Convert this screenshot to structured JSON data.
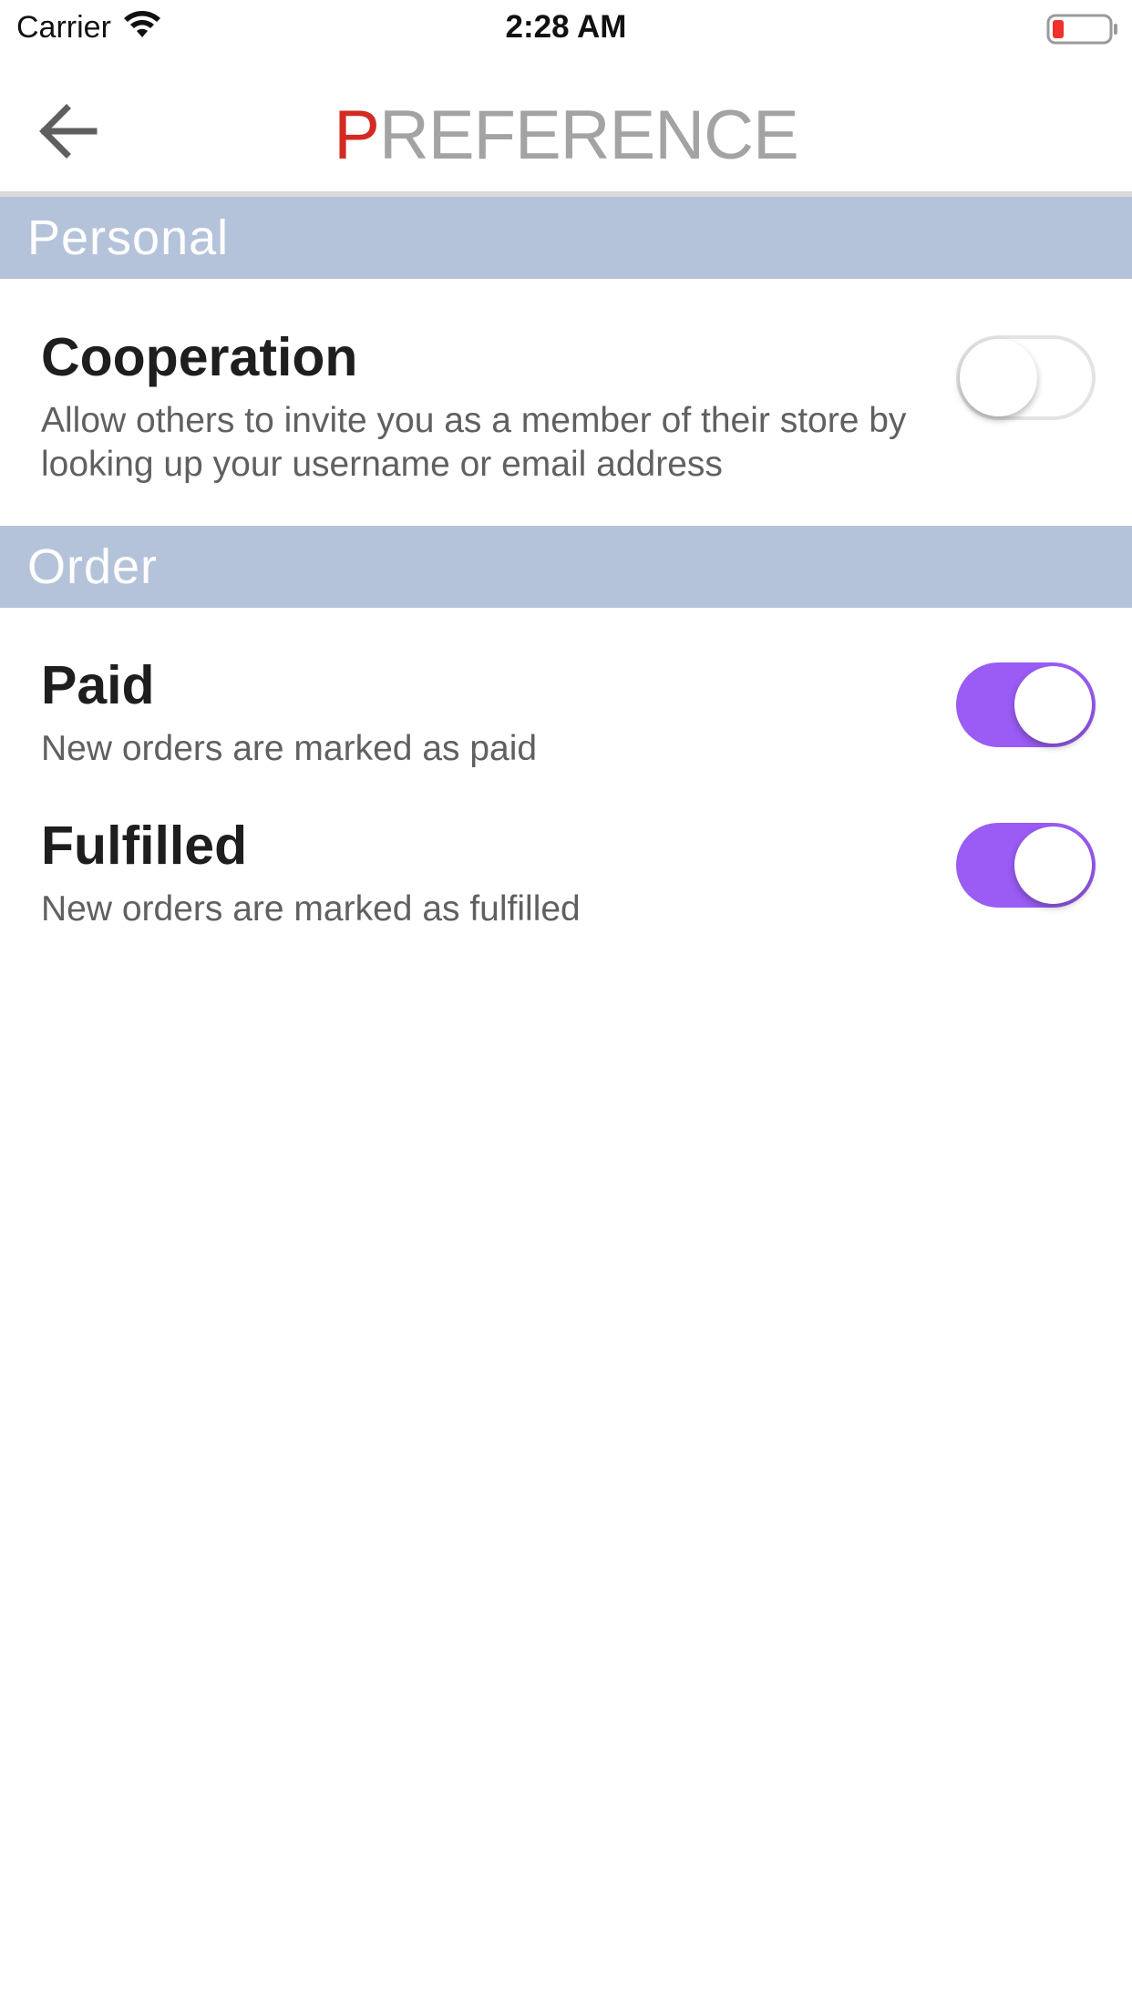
{
  "status_bar": {
    "carrier": "Carrier",
    "time": "2:28 AM",
    "icons": {
      "wifi": "wifi-icon",
      "battery": "battery-low-icon"
    }
  },
  "nav": {
    "back_icon": "arrow-left-icon",
    "title_first_letter": "P",
    "title_rest": "REFERENCE"
  },
  "sections": [
    {
      "label": "Personal",
      "settings": [
        {
          "title": "Cooperation",
          "description": "Allow others to invite you as a member of their store by looking up your username or email address",
          "enabled": false
        }
      ]
    },
    {
      "label": "Order",
      "settings": [
        {
          "title": "Paid",
          "description": "New orders are marked as paid",
          "enabled": true
        },
        {
          "title": "Fulfilled",
          "description": "New orders are marked as fulfilled",
          "enabled": true
        }
      ]
    }
  ],
  "colors": {
    "accent_title": "#d42a22",
    "title_gray": "#a3a3a3",
    "section_header_bg": "#b5c3da",
    "toggle_on": "#9a5cf4",
    "battery_low": "#f0302a"
  }
}
